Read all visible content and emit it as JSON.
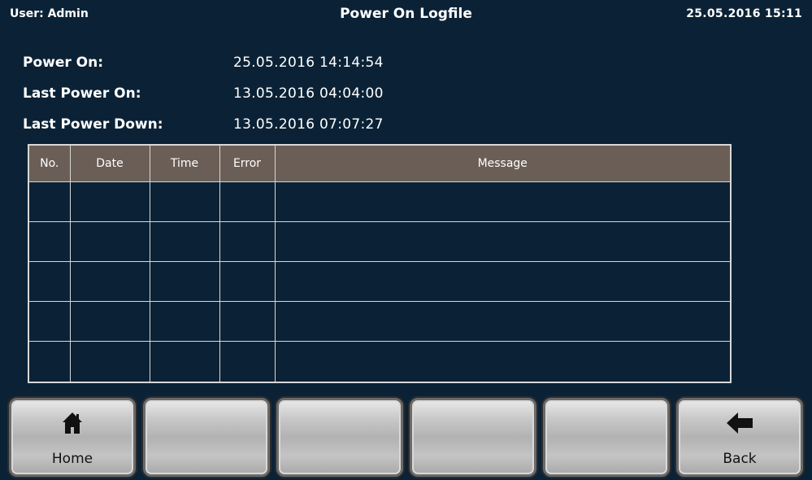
{
  "header": {
    "user": "User: Admin",
    "title": "Power On Logfile",
    "datetime": "25.05.2016  15:11"
  },
  "info": [
    {
      "label": "Power On:",
      "value": "25.05.2016 14:14:54"
    },
    {
      "label": "Last Power On:",
      "value": "13.05.2016 04:04:00"
    },
    {
      "label": "Last Power Down:",
      "value": "13.05.2016 07:07:27"
    }
  ],
  "table": {
    "columns": [
      "No.",
      "Date",
      "Time",
      "Error",
      "Message"
    ],
    "rows": [
      [
        "",
        "",
        "",
        "",
        ""
      ],
      [
        "",
        "",
        "",
        "",
        ""
      ],
      [
        "",
        "",
        "",
        "",
        ""
      ],
      [
        "",
        "",
        "",
        "",
        ""
      ],
      [
        "",
        "",
        "",
        "",
        ""
      ]
    ]
  },
  "buttons": [
    {
      "label": "Home",
      "icon": "home-icon"
    },
    {
      "label": "",
      "icon": ""
    },
    {
      "label": "",
      "icon": ""
    },
    {
      "label": "",
      "icon": ""
    },
    {
      "label": "",
      "icon": ""
    },
    {
      "label": "Back",
      "icon": "arrow-left-icon"
    }
  ]
}
